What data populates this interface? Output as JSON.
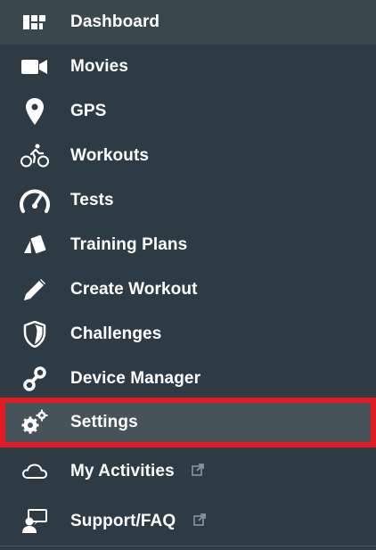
{
  "menu": {
    "items": [
      {
        "label": "Dashboard",
        "icon": "dashboard-icon"
      },
      {
        "label": "Movies",
        "icon": "video-camera-icon"
      },
      {
        "label": "GPS",
        "icon": "map-pin-icon"
      },
      {
        "label": "Workouts",
        "icon": "cyclist-icon"
      },
      {
        "label": "Tests",
        "icon": "gauge-icon"
      },
      {
        "label": "Training Plans",
        "icon": "cards-icon"
      },
      {
        "label": "Create Workout",
        "icon": "pencil-icon"
      },
      {
        "label": "Challenges",
        "icon": "shield-icon"
      },
      {
        "label": "Device Manager",
        "icon": "chain-link-icon"
      },
      {
        "label": "Settings",
        "icon": "gears-icon"
      },
      {
        "label": "My Activities",
        "icon": "cloud-icon",
        "external": true
      },
      {
        "label": "Support/FAQ",
        "icon": "support-chat-icon",
        "external": true
      }
    ],
    "selected": "Settings"
  },
  "colors": {
    "background": "#2e3b44",
    "selected_background": "#46535b",
    "highlight_outline": "#e31b23",
    "text": "#ffffff",
    "external_icon": "#8a969e"
  }
}
